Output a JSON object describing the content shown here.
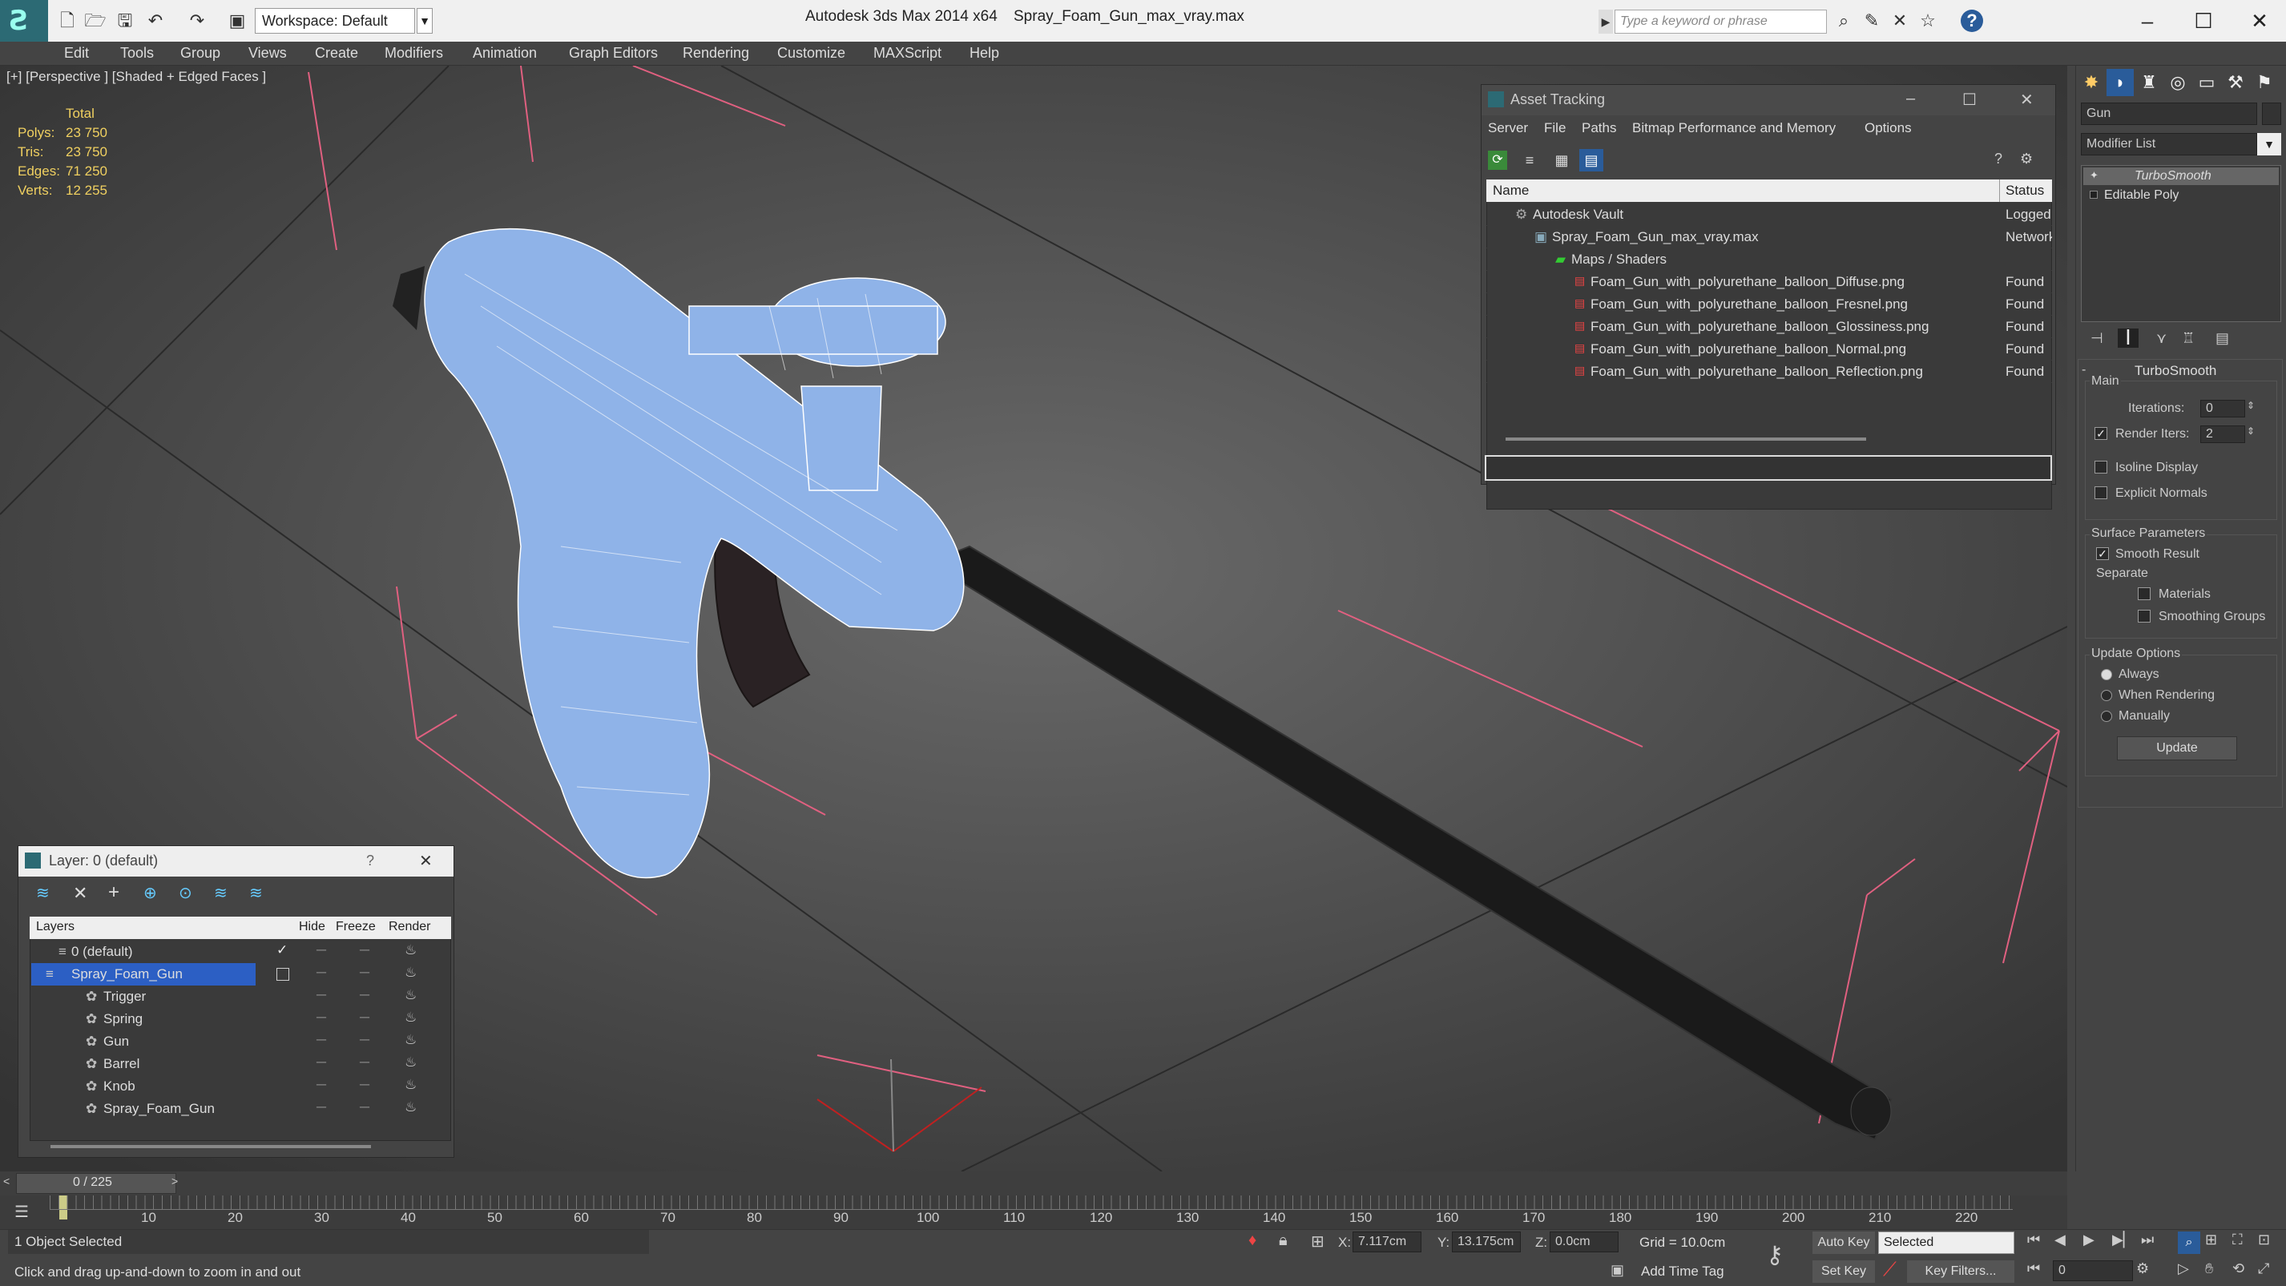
{
  "titlebar": {
    "workspace": "Workspace: Default",
    "app_title": "Autodesk 3ds Max  2014 x64",
    "document": "Spray_Foam_Gun_max_vray.max",
    "search_placeholder": "Type a keyword or phrase",
    "help": "?"
  },
  "menu": [
    "Edit",
    "Tools",
    "Group",
    "Views",
    "Create",
    "Modifiers",
    "Animation",
    "Graph Editors",
    "Rendering",
    "Customize",
    "MAXScript",
    "Help"
  ],
  "viewport": {
    "label": "[+] [Perspective ] [Shaded + Edged Faces ]",
    "stats_header": "Total",
    "stats": [
      {
        "label": "Polys:",
        "value": "23 750"
      },
      {
        "label": "Tris:",
        "value": "23 750"
      },
      {
        "label": "Edges:",
        "value": "71 250"
      },
      {
        "label": "Verts:",
        "value": "12 255"
      }
    ]
  },
  "asset_tracking": {
    "title": "Asset Tracking",
    "menu": [
      "Server",
      "File",
      "Paths",
      "Bitmap Performance and Memory",
      "Options"
    ],
    "col_name": "Name",
    "col_status": "Status",
    "rows": [
      {
        "name": "Autodesk Vault",
        "status": "Logged"
      },
      {
        "name": "Spray_Foam_Gun_max_vray.max",
        "status": "Network"
      },
      {
        "name": "Maps / Shaders",
        "status": ""
      },
      {
        "name": "Foam_Gun_with_polyurethane_balloon_Diffuse.png",
        "status": "Found"
      },
      {
        "name": "Foam_Gun_with_polyurethane_balloon_Fresnel.png",
        "status": "Found"
      },
      {
        "name": "Foam_Gun_with_polyurethane_balloon_Glossiness.png",
        "status": "Found"
      },
      {
        "name": "Foam_Gun_with_polyurethane_balloon_Normal.png",
        "status": "Found"
      },
      {
        "name": "Foam_Gun_with_polyurethane_balloon_Reflection.png",
        "status": "Found"
      }
    ]
  },
  "layer_dialog": {
    "title": "Layer: 0 (default)",
    "help": "?",
    "col_layers": "Layers",
    "col_hide": "Hide",
    "col_freeze": "Freeze",
    "col_render": "Render",
    "rows": [
      "0 (default)",
      "Spray_Foam_Gun",
      "Trigger",
      "Spring",
      "Gun",
      "Barrel",
      "Knob",
      "Spray_Foam_Gun"
    ]
  },
  "command_panel": {
    "object_name": "Gun",
    "modifier_list": "Modifier List",
    "stack": [
      "TurboSmooth",
      "Editable Poly"
    ],
    "rollout_title": "TurboSmooth",
    "main_label": "Main",
    "iterations_label": "Iterations:",
    "iterations_value": "0",
    "render_iters_label": "Render Iters:",
    "render_iters_value": "2",
    "isoline": "Isoline Display",
    "explicit_normals": "Explicit Normals",
    "surface_params": "Surface Parameters",
    "smooth_result": "Smooth Result",
    "separate": "Separate",
    "materials": "Materials",
    "smoothing_groups": "Smoothing Groups",
    "update_options": "Update Options",
    "always": "Always",
    "when_rendering": "When Rendering",
    "manually": "Manually",
    "update_button": "Update"
  },
  "timeline": {
    "frame_display": "0 / 225",
    "ticks": [
      "10",
      "20",
      "30",
      "40",
      "50",
      "60",
      "70",
      "80",
      "90",
      "100",
      "110",
      "120",
      "130",
      "140",
      "150",
      "160",
      "170",
      "180",
      "190",
      "200",
      "210",
      "220"
    ]
  },
  "status": {
    "selection": "1 Object Selected",
    "prompt": "Click and drag up-and-down to zoom in and out",
    "x_label": "X:",
    "x_value": "7.117cm",
    "y_label": "Y:",
    "y_value": "13.175cm",
    "z_label": "Z:",
    "z_value": "0.0cm",
    "grid": "Grid = 10.0cm",
    "add_time_tag": "Add Time Tag",
    "auto_key": "Auto Key",
    "selected": "Selected",
    "set_key": "Set Key",
    "key_filters": "Key Filters...",
    "frame": "0"
  }
}
